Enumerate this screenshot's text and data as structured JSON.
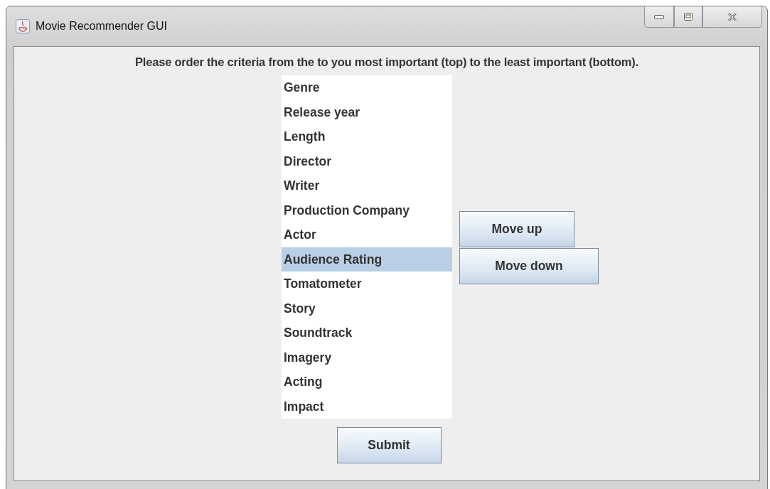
{
  "window": {
    "title": "Movie Recommender GUI"
  },
  "instruction": "Please order the criteria from the to you most important (top) to the least important (bottom).",
  "criteria": [
    {
      "label": "Genre",
      "selected": false
    },
    {
      "label": "Release year",
      "selected": false
    },
    {
      "label": "Length",
      "selected": false
    },
    {
      "label": "Director",
      "selected": false
    },
    {
      "label": "Writer",
      "selected": false
    },
    {
      "label": "Production Company",
      "selected": false
    },
    {
      "label": "Actor",
      "selected": false
    },
    {
      "label": "Audience Rating",
      "selected": true
    },
    {
      "label": "Tomatometer",
      "selected": false
    },
    {
      "label": "Story",
      "selected": false
    },
    {
      "label": "Soundtrack",
      "selected": false
    },
    {
      "label": "Imagery",
      "selected": false
    },
    {
      "label": "Acting",
      "selected": false
    },
    {
      "label": "Impact",
      "selected": false
    }
  ],
  "buttons": {
    "move_up": "Move up",
    "move_down": "Move down",
    "submit": "Submit"
  }
}
